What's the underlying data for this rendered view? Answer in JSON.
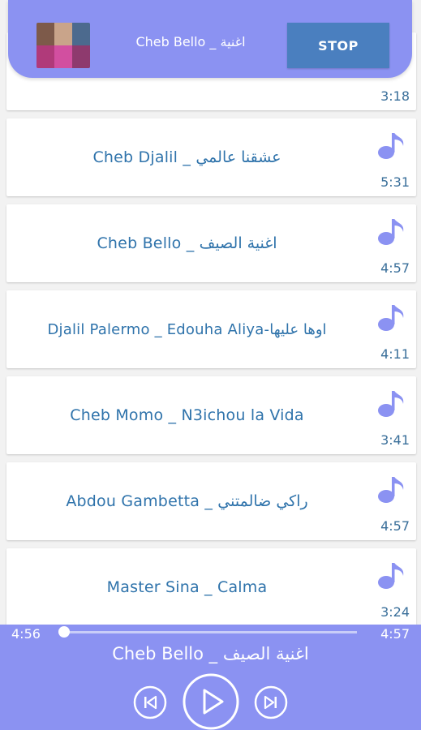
{
  "now_playing": {
    "title": "Cheb Bello _ اغنية",
    "stop_label": "STOP"
  },
  "songs": [
    {
      "title": "",
      "duration": "3:18"
    },
    {
      "title": "Cheb Djalil _ عشقنا عالمي",
      "duration": "5:31"
    },
    {
      "title": "Cheb Bello _ اغنية الصيف",
      "duration": "4:57"
    },
    {
      "title": "Djalil Palermo _ Edouha Aliya-اوها عليها",
      "duration": "4:11"
    },
    {
      "title": "Cheb Momo _ N3ichou la Vida",
      "duration": "3:41"
    },
    {
      "title": "Abdou Gambetta _ راكي ضالمتني",
      "duration": "4:57"
    },
    {
      "title": "Master Sina _ Calma",
      "duration": "3:24"
    }
  ],
  "player": {
    "current_time": "4:56",
    "total_time": "4:57",
    "progress": 0.003,
    "song_title": "Cheb Bello _ اغنية الصيف"
  },
  "icons": {
    "song": "music-note-icon",
    "prev": "skip-previous-icon",
    "play": "play-icon",
    "next": "skip-next-icon"
  },
  "colors": {
    "accent": "#8b92f2",
    "stop_button": "#4a7fbf",
    "song_text": "#2f73ab"
  }
}
